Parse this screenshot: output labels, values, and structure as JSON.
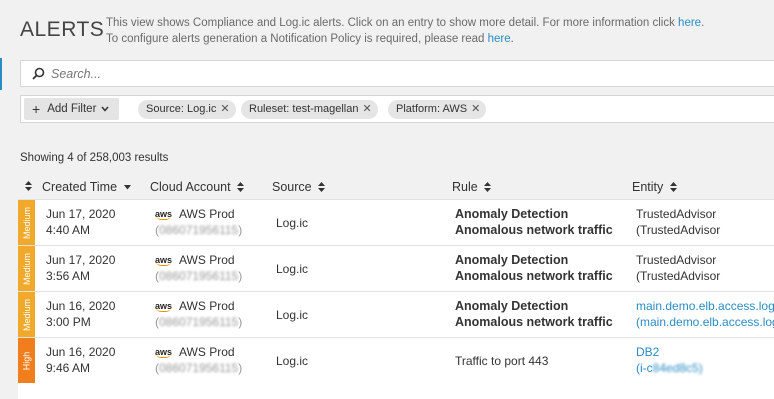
{
  "header": {
    "title": "ALERTS",
    "line1_text": "This view shows Compliance and Log.ic alerts. Click on an entry to show more detail. For more information click ",
    "line1_link": "here",
    "line1_end": ".",
    "line2_text": "To configure alerts generation a Notification Policy is required, please read ",
    "line2_link": "here",
    "line2_end": "."
  },
  "search": {
    "placeholder": "Search...",
    "value": ""
  },
  "filters": {
    "add_label": "Add Filter",
    "chips": [
      {
        "key": "Source:",
        "value": "Log.ic"
      },
      {
        "key": "Ruleset:",
        "value": "test-magellan"
      },
      {
        "key": "Platform:",
        "value": "AWS"
      }
    ]
  },
  "results": {
    "text": "Showing 4 of 258,003 results"
  },
  "table": {
    "columns": {
      "created": "Created Time",
      "account": "Cloud Account",
      "source": "Source",
      "rule": "Rule",
      "entity": "Entity"
    },
    "rows": [
      {
        "severity": "Medium",
        "date": "Jun 17, 2020",
        "time": "4:40 AM",
        "account_logo": "aws",
        "account_name": "AWS Prod",
        "account_id": "086071956115",
        "source": "Log.ic",
        "rule_line1": "Anomaly Detection",
        "rule_line2": "Anomalous network traffic",
        "entity_line1": "TrustedAdvisor",
        "entity_line2": "(TrustedAdvisor"
      },
      {
        "severity": "Medium",
        "date": "Jun 17, 2020",
        "time": "3:56 AM",
        "account_logo": "aws",
        "account_name": "AWS Prod",
        "account_id": "086071956115",
        "source": "Log.ic",
        "rule_line1": "Anomaly Detection",
        "rule_line2": "Anomalous network traffic",
        "entity_line1": "TrustedAdvisor",
        "entity_line2": "(TrustedAdvisor"
      },
      {
        "severity": "Medium",
        "date": "Jun 16, 2020",
        "time": "3:00 PM",
        "account_logo": "aws",
        "account_name": "AWS Prod",
        "account_id": "086071956115",
        "source": "Log.ic",
        "rule_line1": "Anomaly Detection",
        "rule_line2": "Anomalous network traffic",
        "entity_line1": "main.demo.elb.access.log",
        "entity_line2": "(main.demo.elb.access.log"
      },
      {
        "severity": "High",
        "date": "Jun 16, 2020",
        "time": "9:46 AM",
        "account_logo": "aws",
        "account_name": "AWS Prod",
        "account_id": "086071956115",
        "source": "Log.ic",
        "rule_line1": "Traffic to port 443",
        "rule_line2": "",
        "entity_line1": "DB2",
        "entity_line2_prefix": "(i-c",
        "entity_line2_blur": "84ed8c5)"
      }
    ]
  },
  "colors": {
    "medium": "#f0a92a",
    "high": "#f07e1d",
    "link": "#2b8cc4",
    "aws_smile": "#f29100"
  }
}
